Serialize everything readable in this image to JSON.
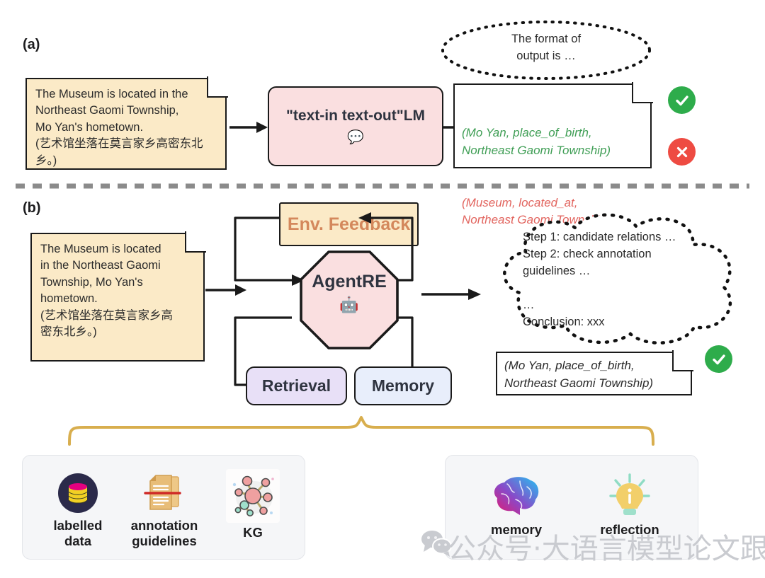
{
  "panels": {
    "a": {
      "label": "(a)",
      "input_note": "The Museum is located in the\nNortheast Gaomi Township,\nMo Yan's hometown.\n(艺术馆坐落在莫言家乡高密东北\n乡。)",
      "model_box": "\"text-in text-out\"LM",
      "model_emoji": "💬",
      "thought": "The format of\noutput is …",
      "output_triple_correct": "(Mo Yan, place_of_birth,\nNortheast Gaomi Township)",
      "output_triple_wrong": "(Museum, located_at,\nNortheast Gaomi Township)",
      "badge_ok": "check-icon",
      "badge_no": "cross-icon"
    },
    "b": {
      "label": "(b)",
      "input_note": "The Museum is located\nin the Northeast Gaomi\nTownship, Mo Yan's\nhometown.\n(艺术馆坐落在莫言家乡高\n密东北乡。)",
      "env_feedback": "Env. Feedback",
      "agent": "AgentRE",
      "agent_emoji": "🤖",
      "retrieval": "Retrieval",
      "memory": "Memory",
      "thought": "Step 1: candidate relations …\nStep 2: check annotation\nguidelines …\n\n…\nConclusion: xxx",
      "output_triple_correct": "(Mo Yan, place_of_birth,\nNortheast Gaomi Township)",
      "badge_ok": "check-icon"
    }
  },
  "resources": {
    "retrieval_card": [
      {
        "caption": "labelled\ndata",
        "icon": "database-icon"
      },
      {
        "caption": "annotation\nguidelines",
        "icon": "documents-icon"
      },
      {
        "caption": "KG",
        "icon": "knowledge-graph-icon"
      }
    ],
    "memory_card": [
      {
        "caption": "memory",
        "icon": "brain-icon"
      },
      {
        "caption": "reflection",
        "icon": "lightbulb-icon"
      }
    ]
  },
  "watermark": {
    "logo": "wechat-icon",
    "text": "公众号·大语言模型论文跟踪"
  },
  "colors": {
    "note_yellow": "#fbeac7",
    "pink": "#fadfe0",
    "purple": "#e8e0f7",
    "blue": "#e8eefb",
    "env_text": "#d4885c",
    "triple_green": "#3f9e55",
    "triple_red": "#e2655f",
    "badge_green": "#2eac4b",
    "badge_red": "#ee4b42",
    "brace_gold": "#d8ae4e",
    "stroke": "#1a1a1a"
  }
}
